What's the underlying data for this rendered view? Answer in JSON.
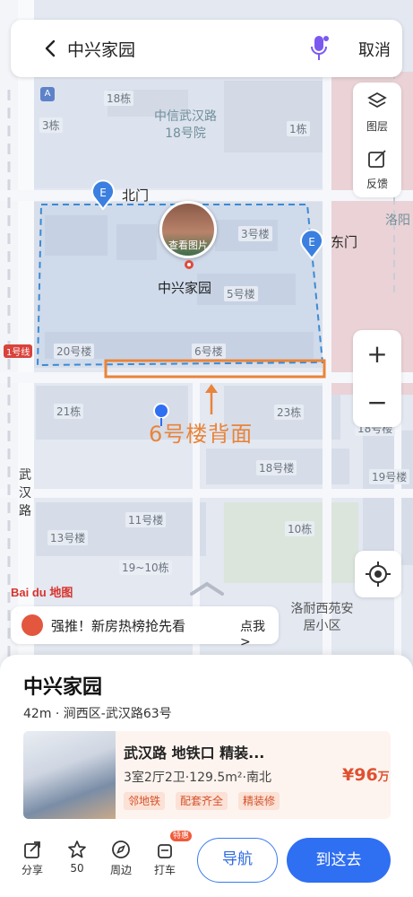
{
  "search": {
    "query": "中兴家园",
    "cancel_label": "取消"
  },
  "side_tools": [
    {
      "label": "图层",
      "icon": "layers-icon"
    },
    {
      "label": "反馈",
      "icon": "feedback-icon"
    }
  ],
  "zoom": {
    "in_label": "+",
    "out_label": "−"
  },
  "map": {
    "gates": {
      "north": "北门",
      "east": "东门"
    },
    "complex_name": "中兴家园",
    "photo_label": "查看图片",
    "places": {
      "zhongxin": "中信武汉路18号院",
      "luoyang": "洛阳",
      "luonai": "洛耐西苑安居小区"
    },
    "buildings": [
      "18栋",
      "3栋",
      "1栋",
      "3号楼",
      "5号楼",
      "20号楼",
      "6号楼",
      "21栋",
      "23栋",
      "18号楼",
      "18号楼",
      "19号楼",
      "11号楼",
      "10栋",
      "13号楼",
      "19~10栋"
    ],
    "road": "武汉路",
    "metro_line": "1号线",
    "annotation": "6号楼背面",
    "logo": "Bai du 地图",
    "colors": {
      "boundary": "#3b8ad6",
      "annotation": "#e9843a"
    }
  },
  "promo": {
    "text": "强推！新房热榜抢先看",
    "cta": "点我 >"
  },
  "detail": {
    "title": "中兴家园",
    "subtitle": "42m · 涧西区-武汉路63号",
    "listing": {
      "title": "武汉路 地铁口 精装...",
      "spec": "3室2厅2卫·129.5m²·南北",
      "price": "¥96",
      "price_unit": "万",
      "tags": [
        "邻地铁",
        "配套齐全",
        "精装修"
      ]
    }
  },
  "actions": [
    {
      "label": "分享"
    },
    {
      "label": "50"
    },
    {
      "label": "周边"
    },
    {
      "label": "打车",
      "badge": "特惠"
    }
  ],
  "nav_label": "导航",
  "go_label": "到这去"
}
